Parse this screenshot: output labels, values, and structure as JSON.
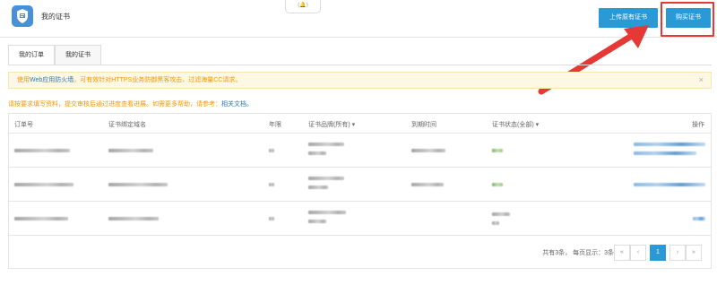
{
  "header": {
    "title": "我的证书",
    "logo_icon": "certificate-shield-icon",
    "collapse_icon": "bell-icon",
    "upload_label": "上传原有证书",
    "buy_label": "购买证书"
  },
  "tabs": [
    {
      "label": "我的订单",
      "active": true
    },
    {
      "label": "我的证书",
      "active": false
    }
  ],
  "alert": {
    "prefix": "使用",
    "link1": "Web应用防火墙",
    "middle": "，可有效针对HTTPS业务防御黑客攻击、过滤海量CC请求。",
    "close": "×"
  },
  "help": {
    "text": "请按要求填写资料，提交审核后通过进度查看进展。如需更多帮助，请参考：",
    "link": "相关文档。"
  },
  "table": {
    "headers": {
      "order_no": "订单号",
      "domain": "证书绑定域名",
      "years": "年限",
      "brand": "证书品牌(所有)",
      "expire": "到期时间",
      "status": "证书状态(全部)",
      "actions": "操作"
    }
  },
  "pager": {
    "info": "共有3条，  每页显示：3条",
    "first": "«",
    "prev": "‹",
    "current": "1",
    "next": "›",
    "last": "»"
  },
  "colors": {
    "primary": "#2a9ad6",
    "warning_text": "#f39800",
    "alert_bg": "#fdf8e3",
    "highlight": "#e53935"
  }
}
